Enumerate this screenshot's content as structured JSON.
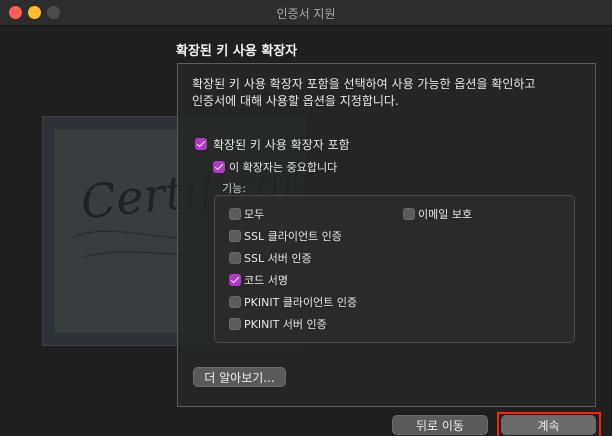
{
  "window": {
    "title": "인증서 지원"
  },
  "section": {
    "title": "확장된 키 사용 확장자"
  },
  "description": [
    "확장된 키 사용 확장자 포함을 선택하여 사용 가능한 옵션을 확인하고",
    "인증서에 대해 사용할 옵션을 지정합니다."
  ],
  "options": {
    "include_label": "확장된 키 사용 확장자 포함",
    "include_checked": true,
    "critical_label": "이 확장자는 중요합니다",
    "critical_checked": true,
    "features_label": "기능:"
  },
  "features": [
    {
      "label": "모두",
      "checked": false
    },
    {
      "label": "SSL 클라이언트 인증",
      "checked": false
    },
    {
      "label": "SSL 서버 인증",
      "checked": false
    },
    {
      "label": "코드 서명",
      "checked": true
    },
    {
      "label": "PKINIT 클라이언트 인증",
      "checked": false
    },
    {
      "label": "PKINIT 서버 인증",
      "checked": false
    },
    {
      "label": "이메일 보호",
      "checked": false
    }
  ],
  "buttons": {
    "learn_more": "더 알아보기...",
    "back": "뒤로 이동",
    "continue": "계속"
  },
  "background_image": {
    "script_text": "Certificate"
  },
  "colors": {
    "accent": "#b238c6",
    "highlight": "#ff1f0a"
  }
}
